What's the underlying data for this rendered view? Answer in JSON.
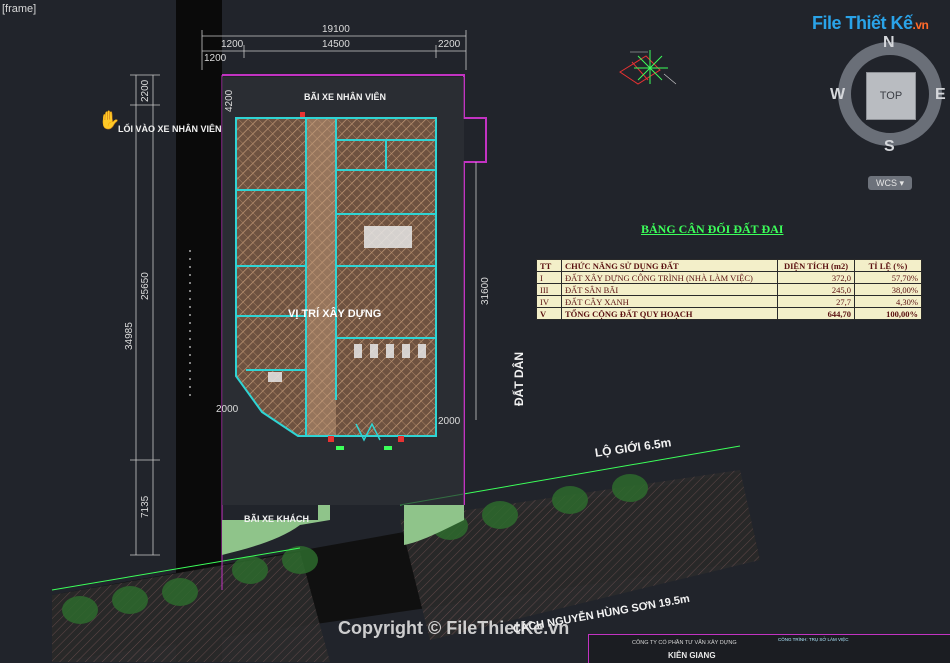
{
  "viewport": {
    "label": "[frame]"
  },
  "logo": {
    "text": "File Thiết Kế",
    "suffix": ".vn"
  },
  "viewcube": {
    "north": "N",
    "south": "S",
    "east": "E",
    "west": "W",
    "top": "TOP",
    "wcs": "WCS"
  },
  "dimensions": {
    "top_total": "19100",
    "top_left": "1200",
    "top_mid": "14500",
    "top_right": "2200",
    "top_left2": "1200",
    "left_a": "2200",
    "left_b": "25650",
    "left_c": "34985",
    "left_d": "7135",
    "left_inner": "4200",
    "right_main": "31600",
    "inner_a": "2000",
    "inner_b": "2000"
  },
  "plan_labels": {
    "entry": "LỐI VÀO XE NHÂN VIÊN",
    "parking_staff": "BÃI XE NHÂN VIÊN",
    "parking_guest": "BÃI XE KHÁCH",
    "site": "VỊ TRÍ XÂY DỰNG",
    "neighbor": "ĐẤT DÂN",
    "road_limit": "LỘ GIỚI 6.5m",
    "road_name": "CÁCH NGUYỄN HÙNG SƠN 19.5m"
  },
  "land_table": {
    "title": "BẢNG CÂN ĐỐI ĐẤT ĐAI",
    "headers": [
      "TT",
      "CHỨC NĂNG SỬ DỤNG ĐẤT",
      "DIỆN TÍCH (m2)",
      "TỈ LỆ (%)"
    ],
    "rows": [
      [
        "I",
        "ĐẤT XÂY DỰNG CÔNG TRÌNH (NHÀ LÀM VIỆC)",
        "372,0",
        "57,70%"
      ],
      [
        "III",
        "ĐẤT SÂN BÃI",
        "245,0",
        "38,00%"
      ],
      [
        "IV",
        "ĐẤT CÂY XANH",
        "27,7",
        "4,30%"
      ],
      [
        "V",
        "TỔNG CỘNG ĐẤT QUY HOẠCH",
        "644,70",
        "100,00%"
      ]
    ]
  },
  "watermark": {
    "copyright": "Copyright © FileThietKe.vn"
  },
  "title_block": {
    "company": "CÔNG TY CỔ PHẦN TƯ VẤN XÂY DỰNG",
    "company_name": "KIÊN GIANG",
    "project": "CÔNG TRÌNH: TRỤ SỞ LÀM VIỆC"
  },
  "colors": {
    "background": "#21242b",
    "site_boundary": "#c233c2",
    "wall": "#2fd4d4",
    "hatch": "#a88060",
    "green": "#3cff5a"
  }
}
